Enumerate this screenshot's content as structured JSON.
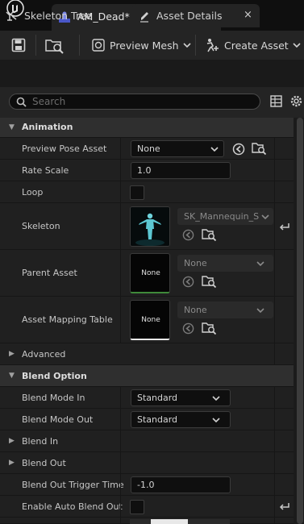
{
  "titlebar": {
    "document_tab": "AM_Dead*",
    "close_glyph": "×"
  },
  "toolbar": {
    "preview_mesh": "Preview Mesh",
    "create_asset": "Create Asset"
  },
  "panel_tabs": {
    "skeleton_tree": "Skeleton Tree",
    "asset_details": "Asset Details",
    "close_glyph": "×"
  },
  "search": {
    "placeholder": "Search"
  },
  "categories": {
    "animation": "Animation",
    "blend_option": "Blend Option"
  },
  "animation": {
    "preview_pose_asset": {
      "label": "Preview Pose Asset",
      "value": "None"
    },
    "rate_scale": {
      "label": "Rate Scale",
      "value": "1.0"
    },
    "loop": {
      "label": "Loop",
      "checked": false
    },
    "skeleton": {
      "label": "Skeleton",
      "value": "SK_Mannequin_S"
    },
    "parent_asset": {
      "label": "Parent Asset",
      "value": "None",
      "thumb": "None"
    },
    "asset_mapping_table": {
      "label": "Asset Mapping Table",
      "value": "None",
      "thumb": "None"
    },
    "advanced": "Advanced"
  },
  "blend": {
    "blend_mode_in": {
      "label": "Blend Mode In",
      "value": "Standard"
    },
    "blend_mode_out": {
      "label": "Blend Mode Out",
      "value": "Standard"
    },
    "blend_in": "Blend In",
    "blend_out": "Blend Out",
    "blend_out_trigger_time": {
      "label": "Blend Out Trigger Time",
      "value": "-1.0"
    },
    "enable_auto_blend_out": {
      "label": "Enable Auto Blend Out",
      "checked": false
    }
  },
  "glyphs": {
    "chevron": "⌄",
    "expanded": "▼",
    "collapsed": "▶"
  },
  "colors": {
    "accent_blue": "#2e7fd8",
    "parent_asset_underline": "#3f8a3a",
    "mapping_underline": "#e8e8e8"
  }
}
